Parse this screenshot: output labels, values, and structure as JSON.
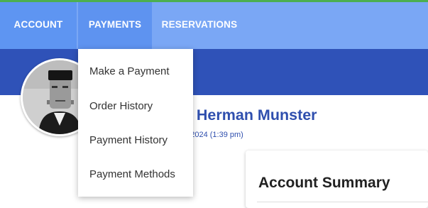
{
  "nav": {
    "items": [
      {
        "label": "ACCOUNT"
      },
      {
        "label": "PAYMENTS"
      },
      {
        "label": "RESERVATIONS"
      }
    ]
  },
  "payments_menu": {
    "items": [
      {
        "label": "Make a Payment"
      },
      {
        "label": "Order History"
      },
      {
        "label": "Payment History"
      },
      {
        "label": "Payment Methods"
      }
    ]
  },
  "profile": {
    "welcome_visible": "e, Herman Munster",
    "last_login_visible": "9, 2024 (1:39 pm)"
  },
  "summary": {
    "title": "Account Summary"
  },
  "colors": {
    "nav_bg": "#7aa7f5",
    "nav_active": "#5e95f2",
    "banner": "#2f52b8",
    "accent_text": "#2f4fae",
    "top_line": "#4caf50"
  },
  "icons": {
    "avatar": "user-portrait"
  }
}
